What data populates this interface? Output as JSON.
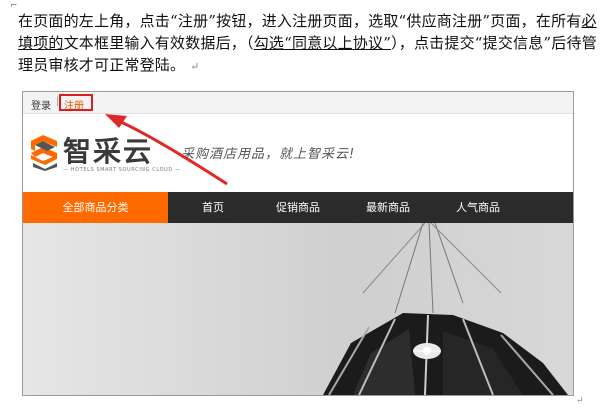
{
  "paragraph": {
    "seg1": "在页面的左上角，点击“注册”按钮，进入注册页面，选取“供应商注册”页面，在所有",
    "seg2_underlined": "必填项的",
    "seg3": "文本框里输入有效数据后，（",
    "seg4_underlined": "勾选“同意以上协议”",
    "seg5": "），点击提交“提交信息”后待管理员审核才可正常登陆。",
    "pilcrow": "↵"
  },
  "screenshot": {
    "topbar": {
      "login": "登录",
      "separator": "|",
      "register": "注册"
    },
    "logo": {
      "text": "智采云",
      "subtitle": "— HOTELS SMART SOURCING CLOUD —",
      "slogan": "采购酒店用品，就上智采云!"
    },
    "nav": {
      "all_categories": "全部商品分类",
      "home": "首页",
      "promotions": "促销商品",
      "newest": "最新商品",
      "popular": "人气商品"
    },
    "colors": {
      "accent": "#ff6a00",
      "nav_bg": "#2b2b2b",
      "highlight": "#d81e1e"
    }
  }
}
